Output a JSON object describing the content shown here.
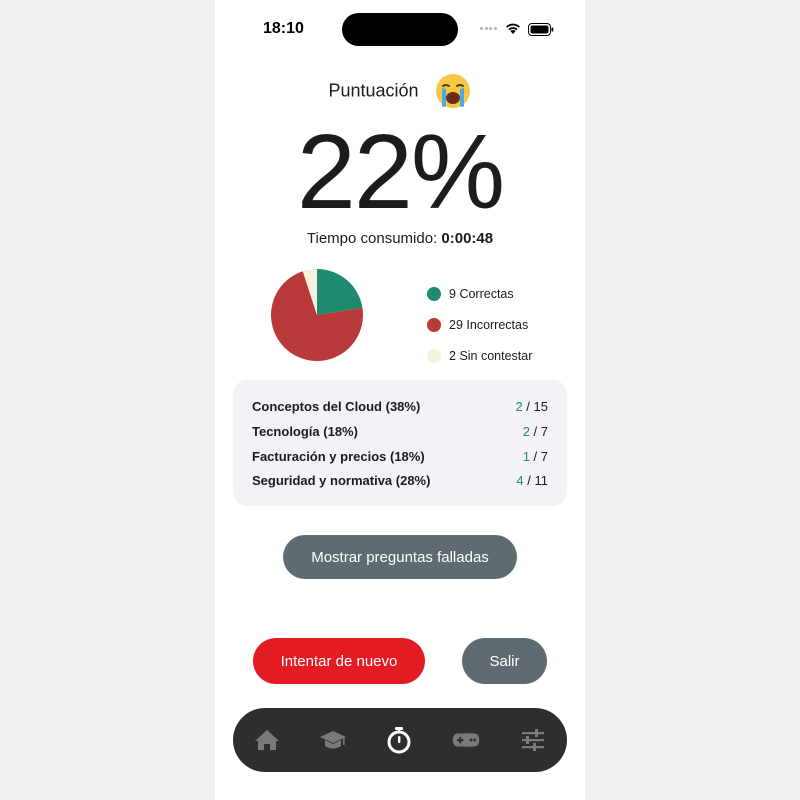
{
  "status": {
    "time": "18:10"
  },
  "score": {
    "label": "Puntuación",
    "value": "22%",
    "time_label": "Tiempo consumido:",
    "time_value": "0:00:48"
  },
  "chart_data": {
    "type": "pie",
    "slices": [
      {
        "label": "Correctas",
        "value": 9,
        "color": "#1f8a70"
      },
      {
        "label": "Incorrectas",
        "value": 29,
        "color": "#b93a3a"
      },
      {
        "label": "Sin contestar",
        "value": 2,
        "color": "#f5f0e0"
      }
    ]
  },
  "legend": [
    {
      "count": "9",
      "label": "Correctas",
      "color": "#1f8a70"
    },
    {
      "count": "29",
      "label": "Incorrectas",
      "color": "#b93a3a"
    },
    {
      "count": "2",
      "label": "Sin contestar",
      "color": "#f5f0e0"
    }
  ],
  "categories": [
    {
      "name": "Conceptos del Cloud (38%)",
      "correct": "2",
      "total": "15"
    },
    {
      "name": "Tecnología (18%)",
      "correct": "2",
      "total": "7"
    },
    {
      "name": "Facturación y precios (18%)",
      "correct": "1",
      "total": "7"
    },
    {
      "name": "Seguridad y normativa (28%)",
      "correct": "4",
      "total": "11"
    }
  ],
  "buttons": {
    "show_failed": "Mostrar preguntas falladas",
    "retry": "Intentar de nuevo",
    "exit": "Salir"
  },
  "tabs": [
    {
      "icon": "home-icon",
      "active": false
    },
    {
      "icon": "graduation-cap-icon",
      "active": false
    },
    {
      "icon": "stopwatch-icon",
      "active": true
    },
    {
      "icon": "gamepad-icon",
      "active": false
    },
    {
      "icon": "sliders-icon",
      "active": false
    }
  ],
  "colors": {
    "correct": "#1f8a70",
    "incorrect": "#b93a3a",
    "unanswered": "#f5f0e0",
    "retry": "#e31b23",
    "secondary": "#5f6b70",
    "tabbar": "#2e2e2e"
  }
}
